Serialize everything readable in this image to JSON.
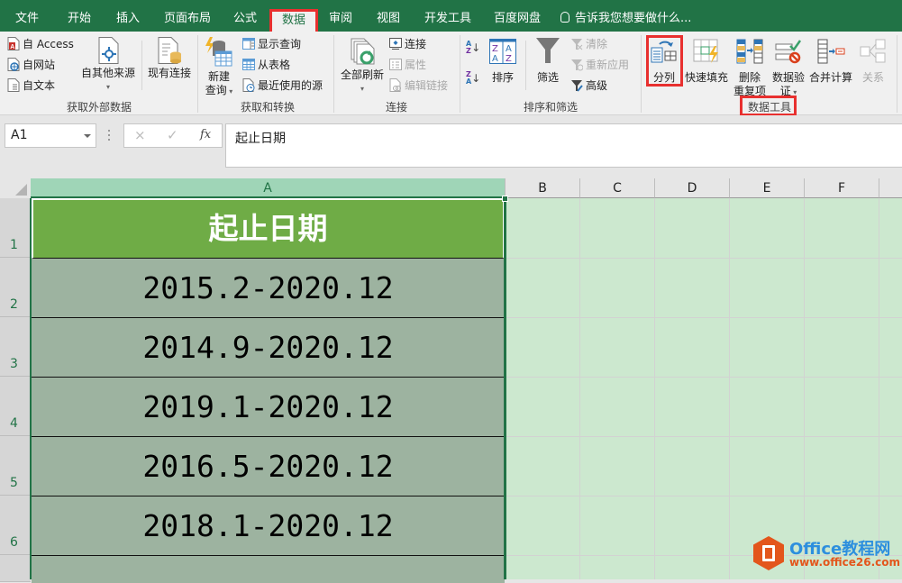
{
  "tabs": [
    {
      "label": "文件",
      "active": false
    },
    {
      "label": "开始",
      "active": false
    },
    {
      "label": "插入",
      "active": false
    },
    {
      "label": "页面布局",
      "active": false
    },
    {
      "label": "公式",
      "active": false
    },
    {
      "label": "数据",
      "active": true
    },
    {
      "label": "审阅",
      "active": false
    },
    {
      "label": "视图",
      "active": false
    },
    {
      "label": "开发工具",
      "active": false
    },
    {
      "label": "百度网盘",
      "active": false
    }
  ],
  "tell_me": {
    "icon": "lightbulb-icon",
    "text": "告诉我您想要做什么..."
  },
  "ribbon": {
    "groups": {
      "external": {
        "label": "获取外部数据",
        "from_access": "自 Access",
        "from_web": "自网站",
        "from_text": "自文本",
        "from_other": "自其他来源",
        "existing_conn": "现有连接"
      },
      "transform": {
        "label": "获取和转换",
        "new_query_1": "新建",
        "new_query_2": "查询",
        "show_queries": "显示查询",
        "from_table": "从表格",
        "recent_sources": "最近使用的源"
      },
      "connections": {
        "label": "连接",
        "refresh_all": "全部刷新",
        "connections": "连接",
        "properties": "属性",
        "edit_links": "编辑链接"
      },
      "sort_filter": {
        "label": "排序和筛选",
        "sort_az": "A→Z",
        "sort_za": "Z→A",
        "sort": "排序",
        "filter": "筛选",
        "clear": "清除",
        "reapply": "重新应用",
        "advanced": "高级"
      },
      "data_tools": {
        "label": "数据工具",
        "text_to_columns": "分列",
        "flash_fill": "快速填充",
        "remove_dup_1": "删除",
        "remove_dup_2": "重复项",
        "validation_1": "数据验",
        "validation_2": "证",
        "consolidate": "合并计算",
        "relationships": "关系"
      }
    }
  },
  "formula_bar": {
    "name_box": "A1",
    "cancel_icon": "×",
    "enter_icon": "✓",
    "fx_label": "fx",
    "content": "起止日期"
  },
  "sheet": {
    "columns": [
      "A",
      "B",
      "C",
      "D",
      "E",
      "F"
    ],
    "selected_column": "A",
    "rows": [
      {
        "num": "1",
        "value": "起止日期"
      },
      {
        "num": "2",
        "value": "2015.2-2020.12"
      },
      {
        "num": "3",
        "value": "2014.9-2020.12"
      },
      {
        "num": "4",
        "value": "2019.1-2020.12"
      },
      {
        "num": "5",
        "value": "2016.5-2020.12"
      },
      {
        "num": "6",
        "value": "2018.1-2020.12"
      }
    ]
  },
  "watermark": {
    "title": "Office教程网",
    "url": "www.office26.com"
  },
  "colors": {
    "brand": "#217346",
    "highlight": "#e8302f",
    "header_cell": "#6fac46",
    "body_cell": "#9db3a0",
    "sheet_bg": "#cce8cf"
  }
}
